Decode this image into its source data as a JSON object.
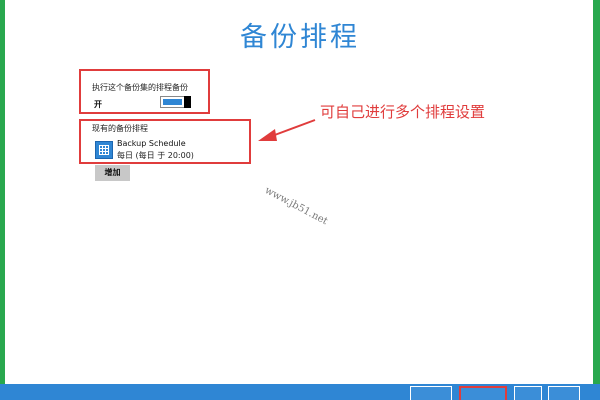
{
  "page": {
    "title": "备份排程"
  },
  "schedule_toggle": {
    "label": "执行这个备份集的排程备份",
    "state_label": "开",
    "enabled": true
  },
  "existing": {
    "label": "现有的备份排程",
    "items": [
      {
        "name": "Backup Schedule",
        "detail": "每日 (每日 于 20:00)",
        "icon": "calendar-icon"
      }
    ]
  },
  "add_button": {
    "label": "增加"
  },
  "annotation": {
    "text": "可自己进行多个排程设置"
  },
  "watermark": {
    "text": "www.jb51.net"
  },
  "colors": {
    "accent": "#2f86d4",
    "highlight": "#e03c3c",
    "edge": "#29a84e"
  }
}
